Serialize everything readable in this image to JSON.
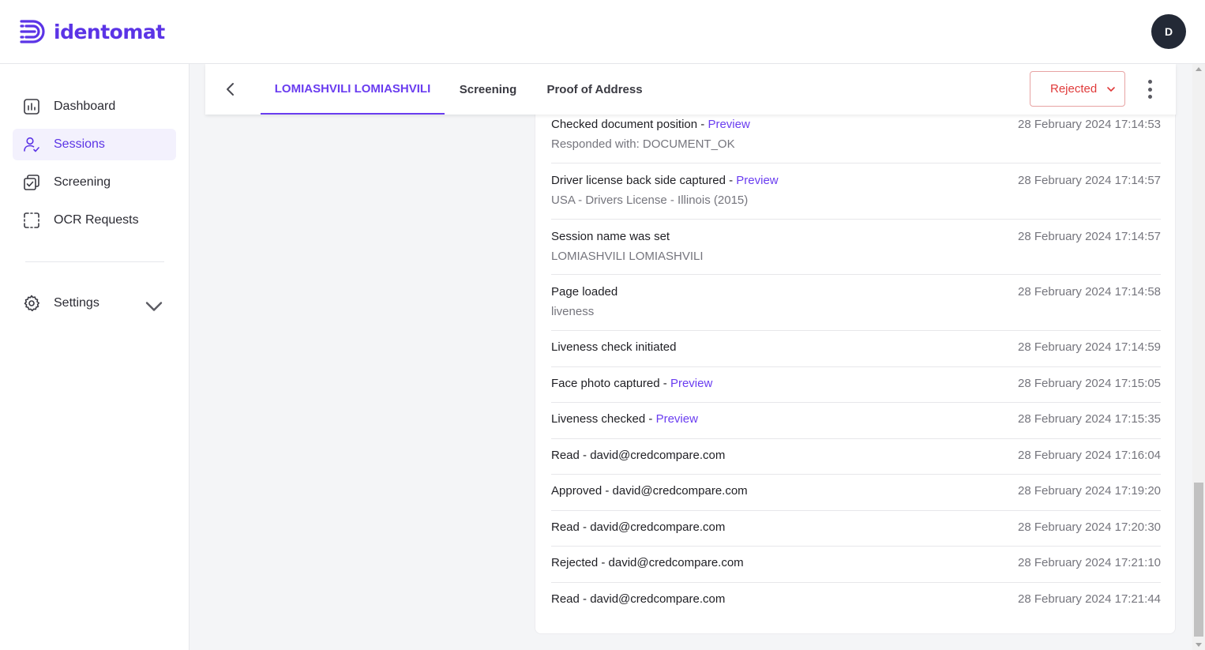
{
  "brand": {
    "name": "identomat",
    "accent": "#5b34e6"
  },
  "user": {
    "avatar_initial": "D"
  },
  "sidebar": {
    "items": [
      {
        "label": "Dashboard",
        "icon": "bar-chart-icon"
      },
      {
        "label": "Sessions",
        "icon": "users-check-icon",
        "active": true
      },
      {
        "label": "Screening",
        "icon": "copy-check-icon"
      },
      {
        "label": "OCR Requests",
        "icon": "scan-frame-icon"
      },
      {
        "label": "Settings",
        "icon": "gear-icon"
      }
    ]
  },
  "tabs": [
    {
      "label": "LOMIASHVILI LOMIASHVILI",
      "active": true
    },
    {
      "label": "Screening"
    },
    {
      "label": "Proof of Address"
    }
  ],
  "status_select": {
    "value": "Rejected",
    "color": "#e03a3a"
  },
  "preview_label": "Preview",
  "events": [
    {
      "title": "Checked document position",
      "has_preview": true,
      "subtitle": "Responded with: DOCUMENT_OK",
      "date": "28 February 2024 17:14:53"
    },
    {
      "title": "Driver license back side captured",
      "has_preview": true,
      "subtitle": "USA - Drivers License - Illinois (2015)",
      "date": "28 February 2024 17:14:57"
    },
    {
      "title": "Session name was set",
      "has_preview": false,
      "subtitle": "LOMIASHVILI LOMIASHVILI",
      "date": "28 February 2024 17:14:57"
    },
    {
      "title": "Page loaded",
      "has_preview": false,
      "subtitle": "liveness",
      "date": "28 February 2024 17:14:58"
    },
    {
      "title": "Liveness check initiated",
      "has_preview": false,
      "subtitle": "",
      "date": "28 February 2024 17:14:59"
    },
    {
      "title": "Face photo captured",
      "has_preview": true,
      "subtitle": "",
      "date": "28 February 2024 17:15:05"
    },
    {
      "title": "Liveness checked",
      "has_preview": true,
      "subtitle": "",
      "date": "28 February 2024 17:15:35"
    },
    {
      "title": "Read - david@credcompare.com",
      "has_preview": false,
      "subtitle": "",
      "date": "28 February 2024 17:16:04"
    },
    {
      "title": "Approved - david@credcompare.com",
      "has_preview": false,
      "subtitle": "",
      "date": "28 February 2024 17:19:20"
    },
    {
      "title": "Read - david@credcompare.com",
      "has_preview": false,
      "subtitle": "",
      "date": "28 February 2024 17:20:30"
    },
    {
      "title": "Rejected - david@credcompare.com",
      "has_preview": false,
      "subtitle": "",
      "date": "28 February 2024 17:21:10"
    },
    {
      "title": "Read - david@credcompare.com",
      "has_preview": false,
      "subtitle": "",
      "date": "28 February 2024 17:21:44"
    }
  ]
}
